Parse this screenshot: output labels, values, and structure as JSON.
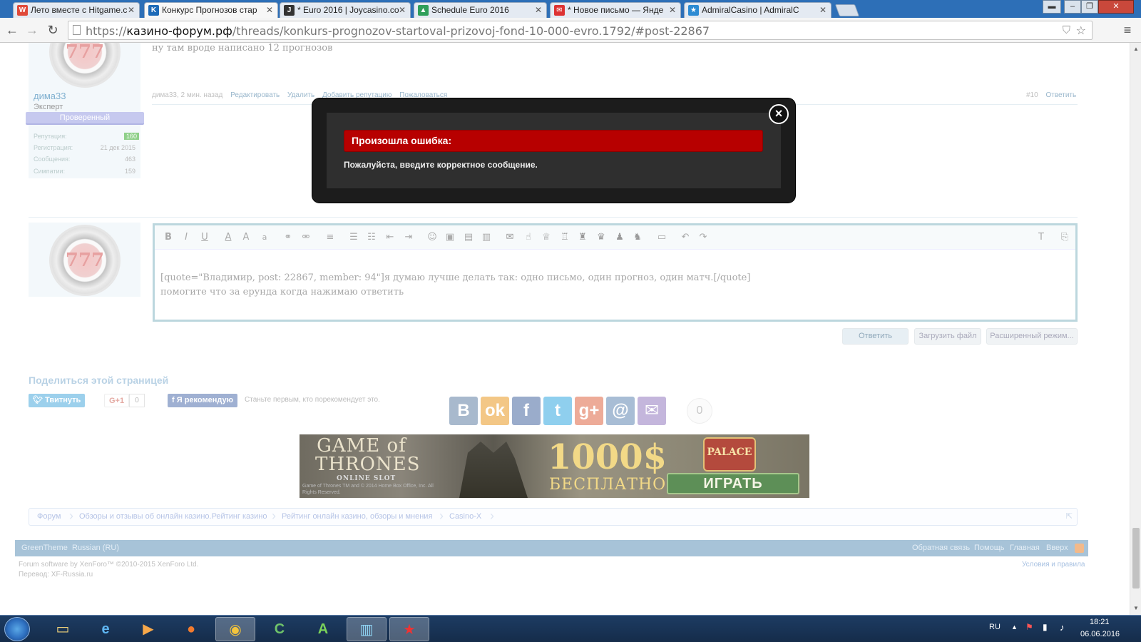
{
  "browser": {
    "tabs": [
      {
        "title": "Лето вместе с Hitgame.c",
        "favicon": "w-icon",
        "fav_color": "#e04a3a",
        "fav_char": "W",
        "active": false
      },
      {
        "title": "Конкурс Прогнозов стар",
        "favicon": "kf-icon",
        "fav_color": "#1e6bb8",
        "fav_char": "K",
        "active": true
      },
      {
        "title": "* Euro 2016 | Joycasino.co",
        "favicon": "joy-icon",
        "fav_color": "#333333",
        "fav_char": "J",
        "active": false
      },
      {
        "title": "Schedule Euro 2016",
        "favicon": "drive-icon",
        "fav_color": "#2f9f5a",
        "fav_char": "▲",
        "active": false
      },
      {
        "title": "* Новое письмо — Янде",
        "favicon": "mail-icon",
        "fav_color": "#d33",
        "fav_char": "✉",
        "active": false
      },
      {
        "title": "AdmiralCasino | AdmiralC",
        "favicon": "star-icon",
        "fav_color": "#2d8bd3",
        "fav_char": "★",
        "active": false
      }
    ],
    "url_prefix": "https://",
    "url_host": "казино-форум.рф",
    "url_path": "/threads/konkurs-prognozov-startoval-prizovoj-fond-10-000-evro.1792/#post-22867"
  },
  "post": {
    "message": "ну там вроде написано 12 прогнозов",
    "username": "дима33",
    "user_title": "Эксперт",
    "badge": "Проверенный",
    "stats": [
      {
        "label": "Репутация:",
        "value": "160"
      },
      {
        "label": "Регистрация:",
        "value": "21 дек 2015"
      },
      {
        "label": "Сообщения:",
        "value": "463"
      },
      {
        "label": "Симпатии:",
        "value": "159"
      }
    ],
    "meta_author": "дима33, 2 мин. назад",
    "actions": [
      "Редактировать",
      "Удалить",
      "Добавить репутацию",
      "Пожаловаться"
    ],
    "number": "#10",
    "reply": "Ответить"
  },
  "avatar_text": "777",
  "editor": {
    "line1": "[quote=\"Владимир, post: 22867, member: 94\"]я думаю лучше делать так: одно письмо, один прогноз, один матч.[/quote]",
    "line2": "помогите что за ерунда когда нажимаю ответить",
    "tools": [
      "bold-icon",
      "italic-icon",
      "underline-icon",
      "font-color-icon",
      "font-size-icon",
      "font-family-icon",
      "link-icon",
      "unlink-icon",
      "align-icon",
      "bullet-list-icon",
      "numbered-list-icon",
      "outdent-icon",
      "indent-icon",
      "smiley-icon",
      "image-icon",
      "media-icon",
      "quote-icon",
      "speech-icon",
      "like-icon",
      "trophy-icon",
      "cup1-icon",
      "cup2-icon",
      "cup3-icon",
      "user-icon",
      "users-icon",
      "save-icon",
      "undo-icon",
      "redo-icon"
    ],
    "buttons": {
      "reply": "Ответить",
      "upload": "Загрузить файл",
      "advanced": "Расширенный режим..."
    }
  },
  "share": {
    "title": "Поделиться этой страницей",
    "tweet": "Твитнуть",
    "gplus": "G+1",
    "gplus_count": "0",
    "fb": "Я рекомендую",
    "fb_text": "Станьте первым, кто порекомендует это.",
    "social_count": "0"
  },
  "banner": {
    "game": "GAME of THRONES",
    "slot": "ONLINE SLOT",
    "copyright": "Game of Thrones TM and © 2014 Home Box Office, Inc. All Rights Reserved.",
    "amount": "1000$",
    "free": "БЕСПЛАТНО",
    "palace": "PALACE",
    "play": "ИГРАТЬ"
  },
  "breadcrumbs": [
    "Форум",
    "Обзоры и отзывы об онлайн казино.Рейтинг казино",
    "Рейтинг онлайн казино, обзоры и мнения",
    "Casino-X"
  ],
  "footer": {
    "left": [
      "GreenTheme",
      "Russian (RU)"
    ],
    "right": [
      "Обратная связь",
      "Помощь",
      "Главная",
      "Вверх"
    ],
    "copyright": "Forum software by XenForo™ ©2010-2015 XenForo Ltd.",
    "translation": "Перевод: XF-Russia.ru",
    "terms": "Условия и правила"
  },
  "modal": {
    "title": "Произошла ошибка:",
    "message": "Пожалуйста, введите корректное сообщение."
  },
  "taskbar": {
    "lang": "RU",
    "time": "18:21",
    "date": "06.06.2016"
  }
}
